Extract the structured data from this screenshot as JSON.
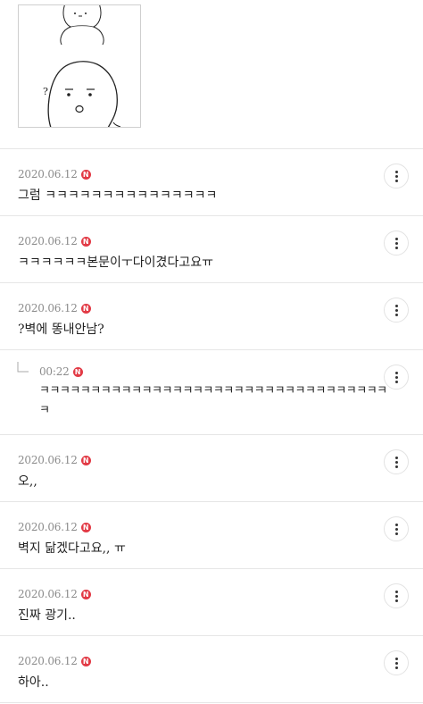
{
  "top": {
    "sketch_mark": "?"
  },
  "comments": [
    {
      "date": "2020.06.12",
      "badge": "N",
      "text": "그럼 ㅋㅋㅋㅋㅋㅋㅋㅋㅋㅋㅋㅋㅋㅋㅋ"
    },
    {
      "date": "2020.06.12",
      "badge": "N",
      "text": "ㅋㅋㅋㅋㅋㅋ본문이ㅜ다이겼다고요ㅠ"
    },
    {
      "date": "2020.06.12",
      "badge": "N",
      "text": "?벽에 똥내안남?"
    }
  ],
  "reply": {
    "date": "00:22",
    "badge": "N",
    "text": "ㅋㅋㅋㅋㅋㅋㅋㅋㅋㅋㅋㅋㅋㅋㅋㅋㅋㅋㅋㅋㅋㅋㅋㅋㅋㅋㅋㅋㅋㅋㅋㅋㅋㅋㅋ"
  },
  "comments2": [
    {
      "date": "2020.06.12",
      "badge": "N",
      "text": "오,,"
    },
    {
      "date": "2020.06.12",
      "badge": "N",
      "text": "벽지 닮겠다고요,, ㅠ"
    },
    {
      "date": "2020.06.12",
      "badge": "N",
      "text": "진짜 광기.."
    },
    {
      "date": "2020.06.12",
      "badge": "N",
      "text": "하아.."
    }
  ]
}
